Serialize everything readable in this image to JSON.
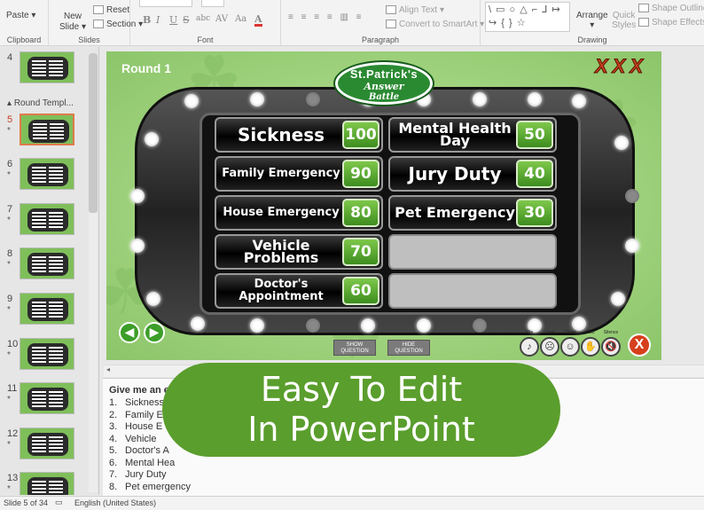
{
  "ribbon": {
    "clipboard": {
      "paste": "Paste",
      "label": "Clipboard"
    },
    "slides": {
      "new_slide_line1": "New",
      "new_slide_line2": "Slide",
      "reset": "Reset",
      "section": "Section",
      "label": "Slides"
    },
    "font": {
      "label": "Font",
      "bold": "B",
      "italic": "I",
      "underline": "U",
      "strike": "S",
      "shadow": "abc",
      "spacing": "AV",
      "case": "Aa",
      "font_color": "A"
    },
    "paragraph": {
      "label": "Paragraph",
      "align_text": "Align Text",
      "convert_smartart": "Convert to SmartArt"
    },
    "drawing": {
      "label": "Drawing",
      "shapes_glyphs": "\\ ▭ ○ △ ⌐ ⅃ ↦ ↪ { } ☆",
      "arrange": "Arrange",
      "quick_styles_line1": "Quick",
      "quick_styles_line2": "Styles",
      "shape_outline": "Shape Outline",
      "shape_effects": "Shape Effects"
    }
  },
  "thumbnails": {
    "section_label": "Round Templ...",
    "slides": [
      {
        "num": "4",
        "star": "",
        "active": false
      },
      {
        "num": "5",
        "star": "*",
        "active": true
      },
      {
        "num": "6",
        "star": "*",
        "active": false
      },
      {
        "num": "7",
        "star": "*",
        "active": false
      },
      {
        "num": "8",
        "star": "*",
        "active": false
      },
      {
        "num": "9",
        "star": "*",
        "active": false
      },
      {
        "num": "10",
        "star": "*",
        "active": false
      },
      {
        "num": "11",
        "star": "*",
        "active": false
      },
      {
        "num": "12",
        "star": "*",
        "active": false
      },
      {
        "num": "13",
        "star": "*",
        "active": false
      }
    ]
  },
  "slide": {
    "round": "Round 1",
    "strikes": "XXX",
    "logo": {
      "line1": "St.Patrick's",
      "line2": "Answer",
      "line3": "Battle"
    },
    "left_column": [
      {
        "answer": "Sickness",
        "points": "100"
      },
      {
        "answer": "Family Emergency",
        "points": "90"
      },
      {
        "answer": "House Emergency",
        "points": "80"
      },
      {
        "answer": "Vehicle Problems",
        "points": "70"
      },
      {
        "answer": "Doctor's Appointment",
        "points": "60"
      }
    ],
    "right_column": [
      {
        "answer": "Mental Health Day",
        "points": "50"
      },
      {
        "answer": "Jury Duty",
        "points": "40"
      },
      {
        "answer": "Pet Emergency",
        "points": "30"
      },
      {
        "answer": "",
        "points": ""
      },
      {
        "answer": "",
        "points": ""
      }
    ],
    "show_question": "SHOW QUESTION",
    "hide_question": "HIDE QUESTION",
    "sound_labels": [
      "Win",
      "Lose",
      "Cheer",
      "Boo",
      "Silence"
    ],
    "close_label": "X"
  },
  "notes": {
    "title": "Give me an e",
    "items": [
      {
        "n": "1.",
        "text": "Sickness"
      },
      {
        "n": "2.",
        "text": "Family E"
      },
      {
        "n": "3.",
        "text": "House E"
      },
      {
        "n": "4.",
        "text": "Vehicle"
      },
      {
        "n": "5.",
        "text": "Doctor's A"
      },
      {
        "n": "6.",
        "text": "Mental Hea"
      },
      {
        "n": "7.",
        "text": "Jury Duty"
      },
      {
        "n": "8.",
        "text": "Pet emergency"
      }
    ]
  },
  "banner": {
    "line1": "Easy To Edit",
    "line2": "In PowerPoint"
  },
  "status": {
    "slide_count": "Slide 5 of 34",
    "language": "English (United States)"
  },
  "colors": {
    "slide_green": "#9fd27d",
    "points_green": "#3d8d1e",
    "strike_red": "#c8401e",
    "banner_green": "#5a9e2d"
  }
}
